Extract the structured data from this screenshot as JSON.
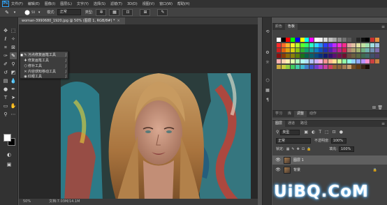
{
  "menubar": {
    "logo": "Ps",
    "items": [
      "文件(F)",
      "编辑(E)",
      "图像(I)",
      "图层(L)",
      "文字(Y)",
      "选择(S)",
      "滤镜(T)",
      "3D(D)",
      "视图(V)",
      "窗口(W)",
      "帮助(H)"
    ]
  },
  "options": {
    "brush_size": "50",
    "mode_label": "模式:",
    "mode_value": "正常",
    "type_label": "类型:"
  },
  "document": {
    "tab_title": "woman-3990680_1920.jpg @ 50% (图层 1, RGB/8#) *",
    "close_glyph": "×"
  },
  "status": {
    "zoom": "50%",
    "doc_info": "文档:7.03M/14.1M"
  },
  "flyout": {
    "items": [
      {
        "label": "污点修复画笔工具",
        "shortcut": "J",
        "selected": true
      },
      {
        "label": "修复画笔工具",
        "shortcut": "J",
        "selected": false
      },
      {
        "label": "修补工具",
        "shortcut": "J",
        "selected": false
      },
      {
        "label": "内容感知移动工具",
        "shortcut": "J",
        "selected": false
      },
      {
        "label": "红眼工具",
        "shortcut": "J",
        "selected": false
      }
    ]
  },
  "swatches_panel": {
    "tabs": [
      "颜色",
      "色板"
    ],
    "active_tab": "色板",
    "colors": [
      "#ffffff",
      "#000000",
      "#ff0000",
      "#00ff00",
      "#0000ff",
      "#ffff00",
      "#00ffff",
      "#ff00ff",
      "#ffffff",
      "#f2f2f2",
      "#d9d9d9",
      "#bfbfbf",
      "#a6a6a6",
      "#8c8c8c",
      "#737373",
      "#595959",
      "#404040",
      "#262626",
      "#0d0d0d",
      "#000000",
      "#c9302c",
      "#e8913c",
      "#ff2a2a",
      "#ff6a2a",
      "#ffb32a",
      "#fff22a",
      "#b8ff2a",
      "#5cff2a",
      "#2aff6a",
      "#2affc8",
      "#2ad9ff",
      "#2a8cff",
      "#2a3dff",
      "#6a2aff",
      "#c02aff",
      "#ff2ad9",
      "#ff2a8c",
      "#e0a0a0",
      "#e0c0a0",
      "#e0e0a0",
      "#c0e0a0",
      "#a0e0b0",
      "#a0e0e0",
      "#a0c0e0",
      "#d12020",
      "#e06010",
      "#e0a010",
      "#d8d010",
      "#90c810",
      "#30b030",
      "#10a070",
      "#10a0a0",
      "#1080c0",
      "#1050c0",
      "#2030b0",
      "#5020b0",
      "#9020b0",
      "#c0208a",
      "#d02050",
      "#b08070",
      "#b0a070",
      "#a0b070",
      "#70b080",
      "#70b0b0",
      "#7090b0",
      "#8070b0",
      "#8a1010",
      "#8a3a08",
      "#8a6a08",
      "#8a8008",
      "#5a8008",
      "#1a701a",
      "#08604a",
      "#08606a",
      "#084a80",
      "#083080",
      "#101a70",
      "#301070",
      "#5a1070",
      "#701050",
      "#701030",
      "#6a4a40",
      "#6a6040",
      "#5a6a40",
      "#406a50",
      "#406a6a",
      "#40506a",
      "#50406a",
      "#ffb0b0",
      "#ffd0b0",
      "#fff0b0",
      "#e0ffb0",
      "#b0ffc0",
      "#b0fff0",
      "#b0e0ff",
      "#b0c0ff",
      "#d0b0ff",
      "#ffb0e0",
      "#ff9090",
      "#ffb890",
      "#ffe090",
      "#d0ff90",
      "#90ffa8",
      "#90ffe8",
      "#90d0ff",
      "#90a8ff",
      "#b890ff",
      "#ff90d0",
      "#cc4040",
      "#cc8040",
      "#ccaa40",
      "#ccc840",
      "#90cc40",
      "#40cc60",
      "#40ccaa",
      "#40b8cc",
      "#4080cc",
      "#4050cc",
      "#7040cc",
      "#b040cc",
      "#cc40a0",
      "#cc4060",
      "#996633",
      "#8c6239",
      "#a67c52",
      "#c69c6d",
      "#754c24",
      "#603913",
      "#3c2415",
      "#1a0e08"
    ]
  },
  "adjust_panel": {
    "tabs": [
      "学习",
      "库",
      "调整",
      "动作"
    ],
    "active_tab": "调整"
  },
  "layers_panel": {
    "tabs": [
      "图层",
      "通道",
      "路径"
    ],
    "active_tab": "图层",
    "filter_value": "类型",
    "blend_mode": "正常",
    "opacity_label": "不透明度:",
    "opacity_value": "100%",
    "lock_label": "锁定:",
    "fill_label": "填充:",
    "fill_value": "100%",
    "layers": [
      {
        "name": "图层 1",
        "selected": true,
        "locked": false
      },
      {
        "name": "背景",
        "selected": false,
        "locked": true
      }
    ]
  },
  "watermark": "UiBQ.CoM",
  "accent_color": "#31a8ff"
}
